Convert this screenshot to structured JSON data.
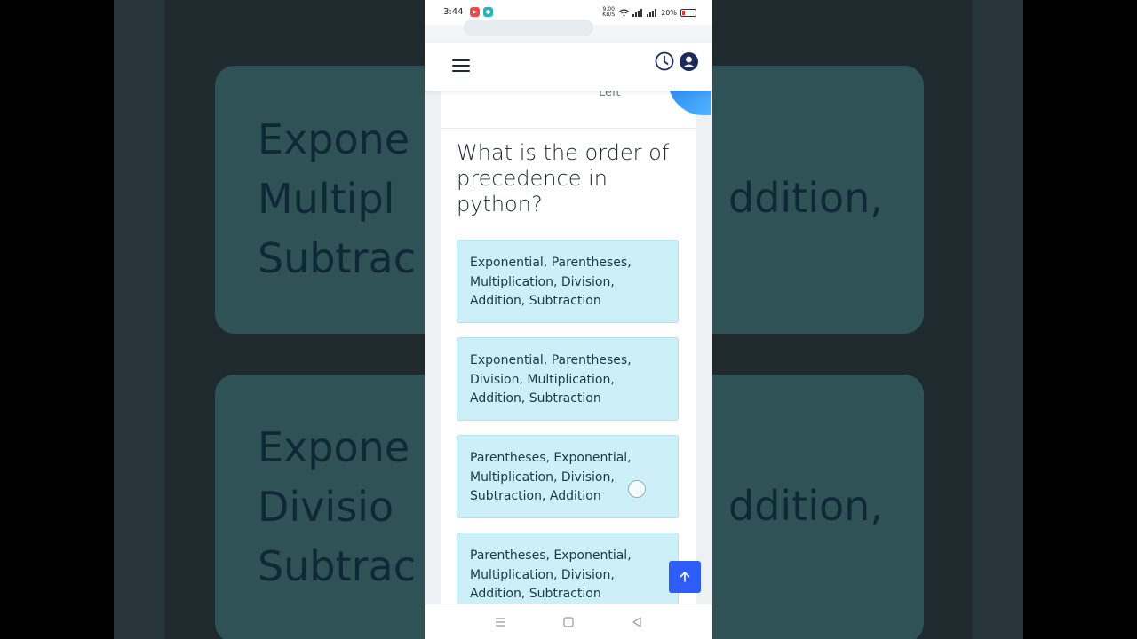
{
  "status_bar": {
    "time": "3:44",
    "network_speed": "9.00 KB/S",
    "battery": "20%"
  },
  "question": {
    "timer_label": "Left",
    "text": "What is the order of precedence in python?"
  },
  "options": [
    {
      "text": "Exponential, Parentheses, Multiplication, Division, Addition, Subtraction"
    },
    {
      "text": "Exponential, Parentheses, Division, Multiplication, Addition, Subtraction"
    },
    {
      "text": "Parentheses, Exponential, Multiplication, Division, Subtraction, Addition"
    },
    {
      "text": "Parentheses, Exponential, Multiplication, Division, Addition, Subtraction"
    }
  ],
  "background": {
    "card1_lines": [
      "Expone",
      "Multipl",
      "Subtrac"
    ],
    "card2_lines": [
      "Expone",
      "Divisio",
      "Subtrac"
    ],
    "right_fragment_1": "ddition,",
    "right_fragment_2": "ddition,"
  },
  "icons": {
    "menu": "hamburger-menu-icon",
    "history": "clock-icon",
    "account": "user-icon",
    "scroll_top": "arrow-up-icon"
  },
  "colors": {
    "accent": "#2e5cf6",
    "option_bg": "#cdeff8",
    "header_icon": "#1a2b5c"
  }
}
